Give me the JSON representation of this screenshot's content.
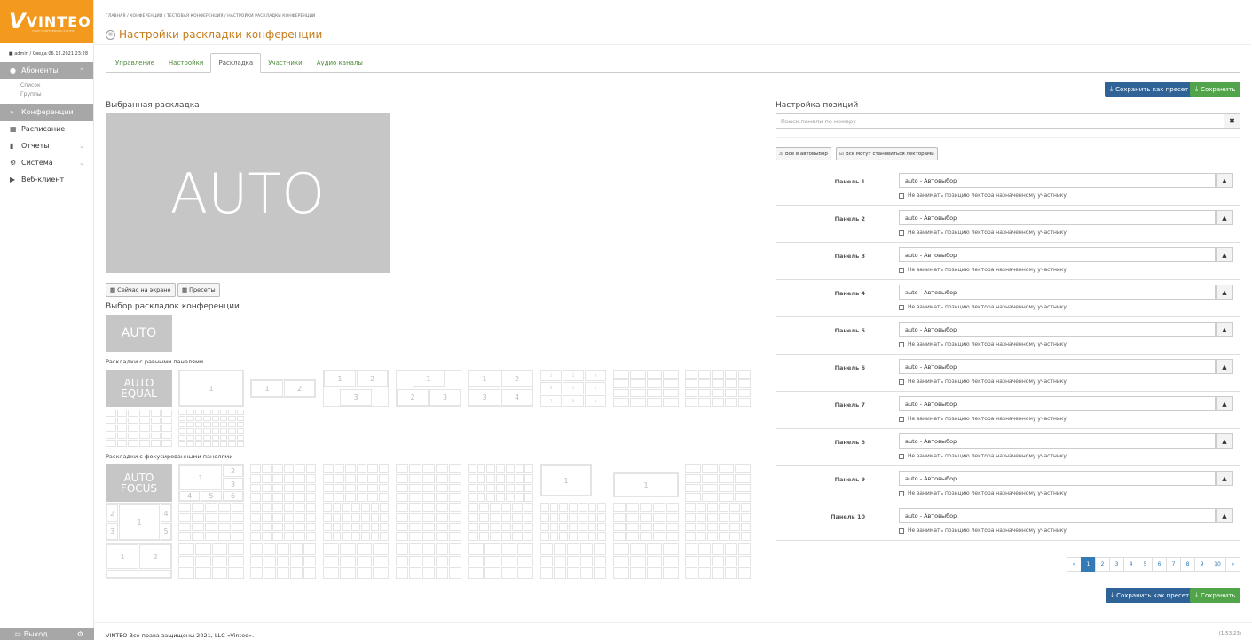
{
  "app": {
    "logo_text": "VINTEO",
    "logo_sub": "VIDEO CONFERENCING SYSTEM",
    "user_line": "admin / Сведа 06.12.2021 23:28"
  },
  "sidebar": {
    "items": [
      {
        "label": "Абоненты",
        "icon": "users-icon",
        "active": true
      },
      {
        "label": "Конференции",
        "icon": "forward-icon",
        "active": true
      },
      {
        "label": "Расписание",
        "icon": "calendar-icon"
      },
      {
        "label": "Отчеты",
        "icon": "book-icon"
      },
      {
        "label": "Система",
        "icon": "cogs-icon"
      },
      {
        "label": "Веб-клиент",
        "icon": "video-icon"
      }
    ],
    "subitems": [
      "Список",
      "Группы"
    ],
    "logout": "Выход"
  },
  "breadcrumb": "ГЛАВНАЯ / КОНФЕРЕНЦИИ / ТЕСТОВАЯ КОНФЕРЕНЦИЯ / НАСТРОЙКИ РАСКЛАДКИ КОНФЕРЕНЦИИ",
  "page_title": "Настройки раскладки конференции",
  "tabs": [
    "Управление",
    "Настройки",
    "Раскладка",
    "Участники",
    "Аудио каналы"
  ],
  "buttons": {
    "save_preset": "Сохранить как пресет",
    "save": "Сохранить",
    "on_screen": "Сейчас на экране",
    "presets": "Пресеты",
    "all_auto": "Все в автовыбор",
    "all_lecturers": "Все могут становиться лекторами"
  },
  "left": {
    "selected_title": "Выбранная раскладка",
    "preview_text": "AUTO",
    "choose_title": "Выбор раскладок конференции",
    "auto_small": "AUTO",
    "equal_title": "Раскладки с равными панелями",
    "auto_equal_1": "AUTO",
    "auto_equal_2": "EQUAL",
    "focus_title": "Раскладки с фокусированными панелями",
    "auto_focus_1": "AUTO",
    "auto_focus_2": "FOCUS",
    "cell_numbers": [
      "1",
      "2",
      "3",
      "4",
      "5",
      "6",
      "7",
      "8",
      "9"
    ]
  },
  "right": {
    "title": "Настройка позиций",
    "search_placeholder": "Поиск панели по номеру",
    "select_value": "auto - Автовыбор",
    "check_label": "Не занимать позицию лектора назначенному участнику",
    "panels": [
      "Панель 1",
      "Панель 2",
      "Панель 3",
      "Панель 4",
      "Панель 5",
      "Панель 6",
      "Панель 7",
      "Панель 8",
      "Панель 9",
      "Панель 10"
    ]
  },
  "pager": {
    "prev": "«",
    "next": "»",
    "pages": [
      "1",
      "2",
      "3",
      "4",
      "5",
      "6",
      "7",
      "8",
      "9",
      "10"
    ],
    "current": "1"
  },
  "footer": {
    "text": "VINTEO   Все права защищены 2021, LLC «Vinteo».",
    "version": "(1.53.23)"
  }
}
